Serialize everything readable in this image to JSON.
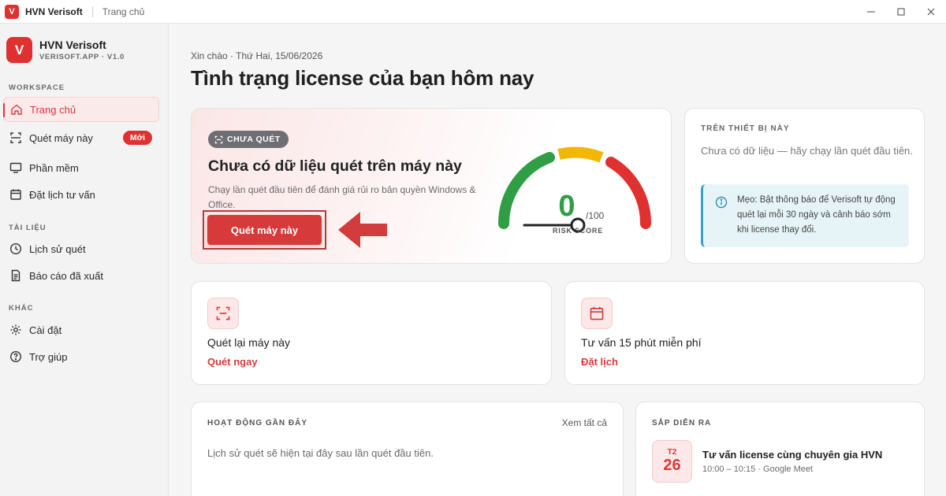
{
  "titlebar": {
    "logo_letter": "V",
    "app_name": "HVN Verisoft",
    "current_page": "Trang chủ",
    "minimize": "—",
    "maximize": "☐",
    "close": "✕"
  },
  "sidebar": {
    "brand": {
      "logo_letter": "V",
      "name": "HVN Verisoft",
      "subtitle": "VERISOFT.APP · V1.0"
    },
    "sections": [
      {
        "label": "WORKSPACE",
        "items": [
          {
            "label": "Trang chủ",
            "icon": "home-icon",
            "active": true
          },
          {
            "label": "Quét máy này",
            "icon": "scan-icon",
            "badge": "Mới"
          },
          {
            "label": "Phần mềm",
            "icon": "monitor-icon"
          },
          {
            "label": "Đặt lịch tư vấn",
            "icon": "calendar-icon"
          }
        ]
      },
      {
        "label": "TÀI LIỆU",
        "items": [
          {
            "label": "Lịch sử quét",
            "icon": "history-icon"
          },
          {
            "label": "Báo cáo đã xuất",
            "icon": "document-icon"
          }
        ]
      },
      {
        "label": "KHÁC",
        "items": [
          {
            "label": "Cài đặt",
            "icon": "gear-icon"
          },
          {
            "label": "Trợ giúp",
            "icon": "help-icon"
          }
        ]
      }
    ]
  },
  "main": {
    "greeting": "Xin chào · Thứ Hai, 15/06/2026",
    "title": "Tình trạng license của bạn hôm nay",
    "hero": {
      "chip": "CHƯA QUÉT",
      "title": "Chưa có dữ liệu quét trên máy này",
      "description": "Chạy lần quét đầu tiên để đánh giá rủi ro bản quyền Windows & Office.",
      "cta": "Quét máy này",
      "gauge": {
        "score": "0",
        "max": "/100",
        "label": "RISK SCORE",
        "value": 0,
        "colors": [
          "#2f9e44",
          "#f2b705",
          "#e03131"
        ]
      }
    },
    "device": {
      "label": "TRÊN THIẾT BỊ NÀY",
      "text": "Chưa có dữ liệu — hãy chạy lần quét đầu tiên.",
      "tip": "Mẹo: Bật thông báo để Verisoft tự động quét lại mỗi 30 ngày và cảnh báo sớm khi license thay đổi."
    },
    "actions": [
      {
        "title": "Quét lại máy này",
        "link": "Quét ngay",
        "icon": "scan-icon"
      },
      {
        "title": "Tư vấn 15 phút miễn phí",
        "link": "Đặt lịch",
        "icon": "calendar-icon"
      }
    ],
    "activity": {
      "heading": "HOẠT ĐỘNG GẦN ĐÂY",
      "see_all": "Xem tất cả",
      "empty": "Lịch sử quét sẽ hiện tại đây sau lần quét đầu tiên."
    },
    "upcoming": {
      "heading": "SẮP DIỄN RA",
      "day_of_week": "T2",
      "day": "26",
      "title": "Tư vấn license cùng chuyên gia HVN",
      "time": "10:00 – 10:15 · Google Meet"
    }
  },
  "colors": {
    "accent": "#d73a3a",
    "accent_light": "#fce8e8",
    "tip_bg": "#e6f4f8",
    "tip_border": "#3a9fc0"
  }
}
